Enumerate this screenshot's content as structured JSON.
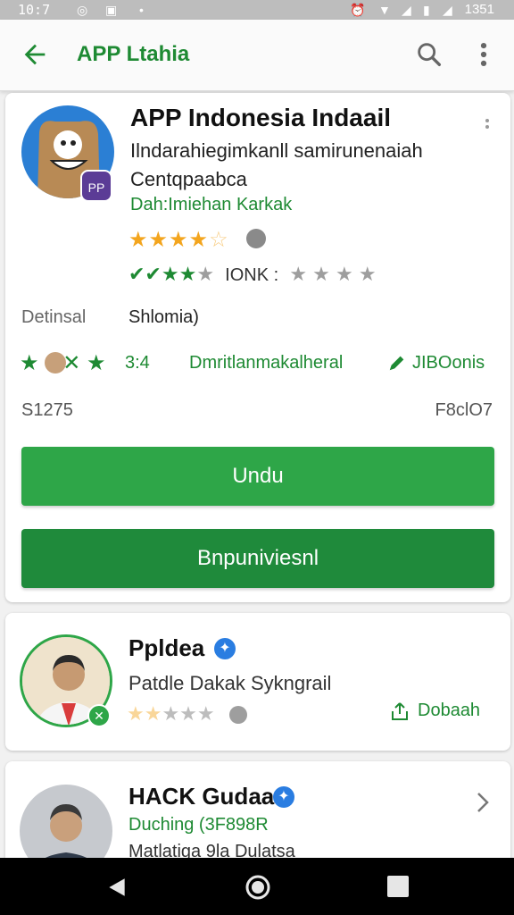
{
  "status_bar": {
    "time": "10:7",
    "clock": "1351"
  },
  "app_bar": {
    "title": "APP Ltahia"
  },
  "app": {
    "icon_badge": "PP",
    "title": "APP Indonesia Indaail",
    "subtitle_1": "Ilndarahiegimkanll samirunenaiah",
    "subtitle_2": "Centqpaabca",
    "developer": "Dah:Imiehan Karkak",
    "rating_count": "IONK :",
    "label_left": "Detinsal",
    "label_right": "Shlomia)",
    "review_count": "3:4",
    "link_text": "Dmritlanmakalheral",
    "link_text_2": "JIBOonis",
    "meta_left": "S1275",
    "meta_right": "F8clO7",
    "install_label": "Undu",
    "secondary_label": "Bnpuniviesnl"
  },
  "card2": {
    "title": "Ppldea",
    "subtitle": "Patdle Dakak Sykngrail",
    "action": "Dobaah"
  },
  "card3": {
    "title": "HACK Gudaa",
    "developer": "Duching (3F898R",
    "subtitle": "Matlatiga 9la Dulatsa"
  },
  "colors": {
    "accent_green": "#1e8a33",
    "button_green": "#2ea648",
    "button_dark_green": "#1f8a3b",
    "star_orange": "#f3a51e",
    "verified_blue": "#2a7de1"
  },
  "icons": [
    "back-arrow-icon",
    "search-icon",
    "more-vert-icon",
    "star-icon",
    "pencil-icon",
    "share-icon",
    "chevron-right-icon",
    "verified-icon",
    "nav-back-icon",
    "nav-home-icon",
    "nav-recent-icon"
  ]
}
